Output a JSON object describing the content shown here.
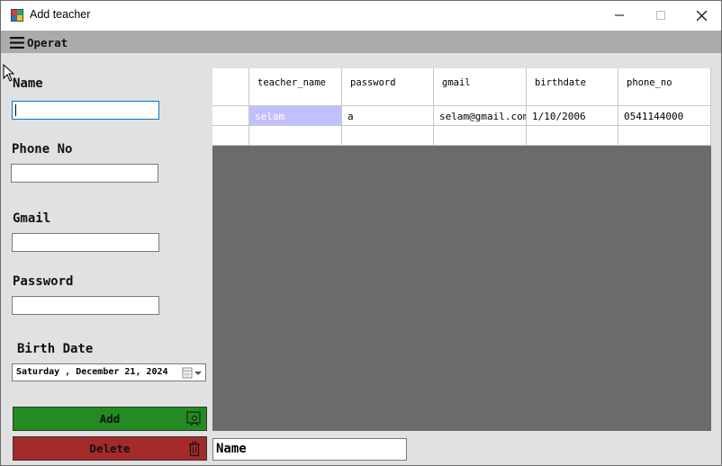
{
  "window": {
    "title": "Add teacher"
  },
  "menu": {
    "items": [
      {
        "label": "Operat",
        "icon": "hamburger-menu-icon"
      }
    ]
  },
  "form": {
    "name_label": "Name",
    "name_value": "",
    "phone_label": "Phone No",
    "phone_value": "",
    "gmail_label": "Gmail",
    "gmail_value": "",
    "password_label": "Password",
    "password_value": "",
    "birthdate_label": "Birth Date",
    "birthdate_value": "Saturday , December 21, 2024",
    "add_label": "Add",
    "delete_label": "Delete"
  },
  "grid": {
    "columns": [
      "teacher_name",
      "password",
      "gmail",
      "birthdate",
      "phone_no"
    ],
    "rows": [
      [
        "selam",
        "a",
        "selam@gmail.com",
        "1/10/2006",
        "0541144000"
      ]
    ]
  },
  "search": {
    "value": "Name"
  },
  "colors": {
    "add_button": "#228b22",
    "delete_button": "#a52a2a",
    "menu_bar": "#ababab",
    "grid_background": "#6b6b6b",
    "selected_cell": "#c0c0ff"
  }
}
